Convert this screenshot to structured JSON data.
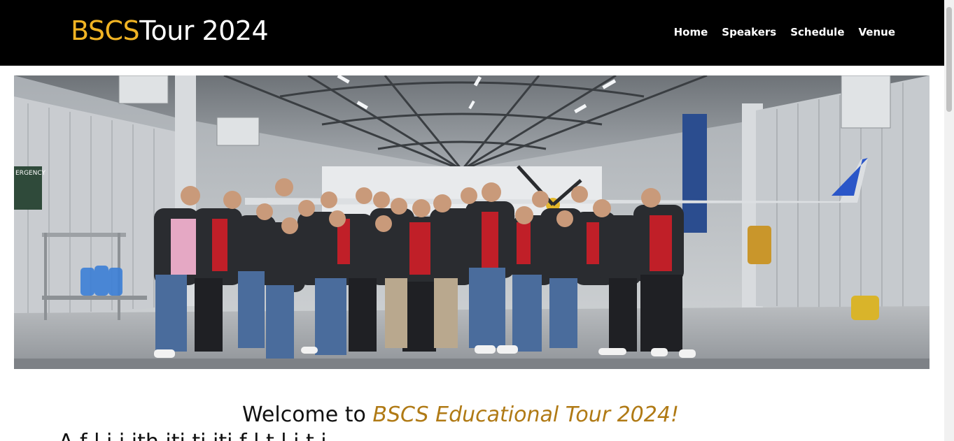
{
  "header": {
    "brand_accent": "BSCS",
    "brand_rest": "Tour 2024",
    "nav": [
      {
        "label": "Home"
      },
      {
        "label": "Speakers"
      },
      {
        "label": "Schedule"
      },
      {
        "label": "Venue"
      }
    ]
  },
  "hero": {
    "sign_text": "ERGENCY"
  },
  "welcome": {
    "prefix": "Welcome to ",
    "highlight": "BSCS Educational Tour 2024!",
    "intro_line": "A f        l                  i  i  ith    iti      ti iti    f     l   t         l         i        t    i"
  },
  "colors": {
    "header_bg": "#000000",
    "brand_accent": "#f0b323",
    "welcome_accent": "#b07a15"
  }
}
